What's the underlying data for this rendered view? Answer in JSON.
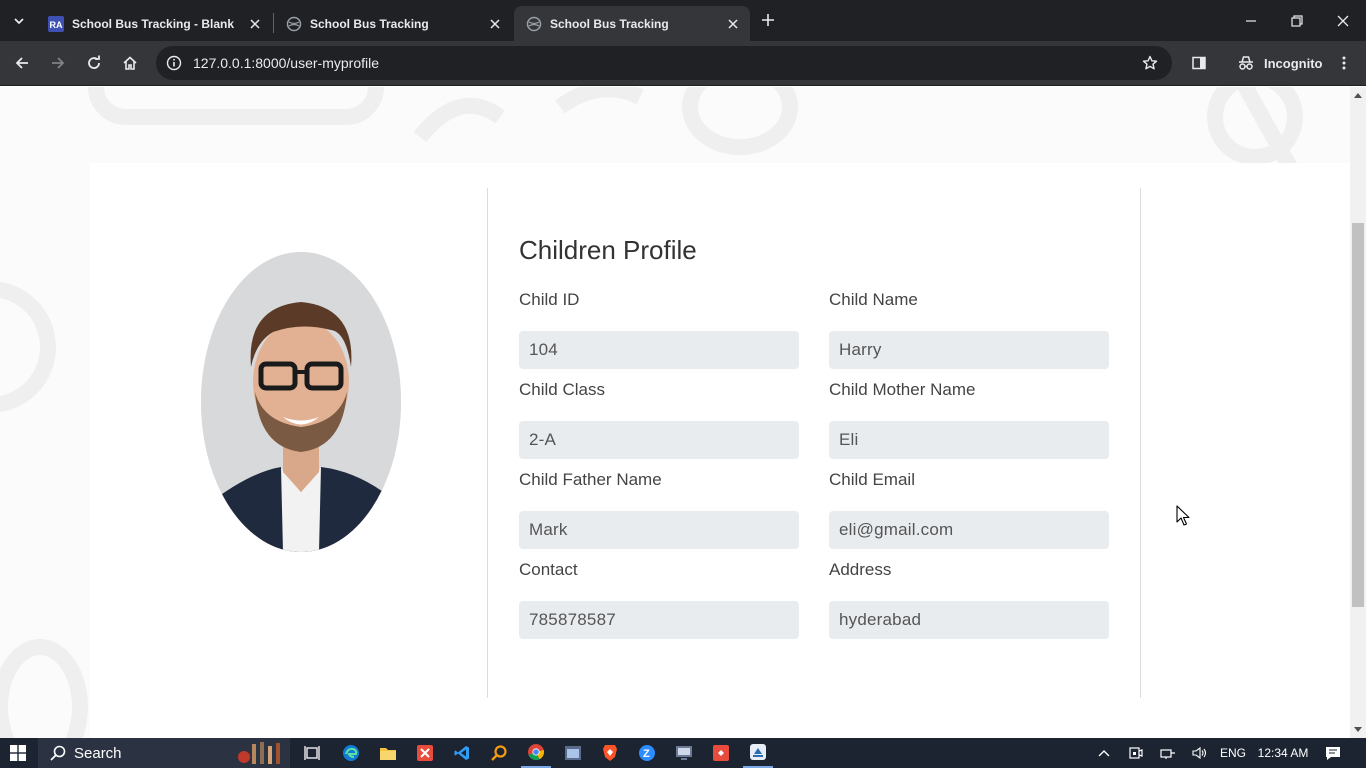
{
  "browser": {
    "tabs": [
      {
        "title": "School Bus Tracking - Blank Pa",
        "favicon": "ra-icon",
        "active": false
      },
      {
        "title": "School Bus Tracking",
        "favicon": "globe-icon",
        "active": false
      },
      {
        "title": "School Bus Tracking",
        "favicon": "globe-icon",
        "active": true
      }
    ],
    "url": "127.0.0.1:8000/user-myprofile",
    "incognito_label": "Incognito"
  },
  "profile": {
    "heading": "Children Profile",
    "fields": [
      {
        "label": "Child ID",
        "value": "104"
      },
      {
        "label": "Child Name",
        "value": "Harry"
      },
      {
        "label": "Child Class",
        "value": "2-A"
      },
      {
        "label": "Child Mother Name",
        "value": "Eli"
      },
      {
        "label": "Child Father Name",
        "value": "Mark"
      },
      {
        "label": "Child Email",
        "value": "eli@gmail.com"
      },
      {
        "label": "Contact",
        "value": "785878587"
      },
      {
        "label": "Address",
        "value": "hyderabad"
      }
    ]
  },
  "taskbar": {
    "search_label": "Search",
    "language": "ENG",
    "time": "12:34 AM"
  },
  "colors": {
    "chrome_dark": "#202124",
    "chrome_toolbar": "#35363a",
    "input_bg": "#e9ecef",
    "taskbar": "#1c2331"
  }
}
